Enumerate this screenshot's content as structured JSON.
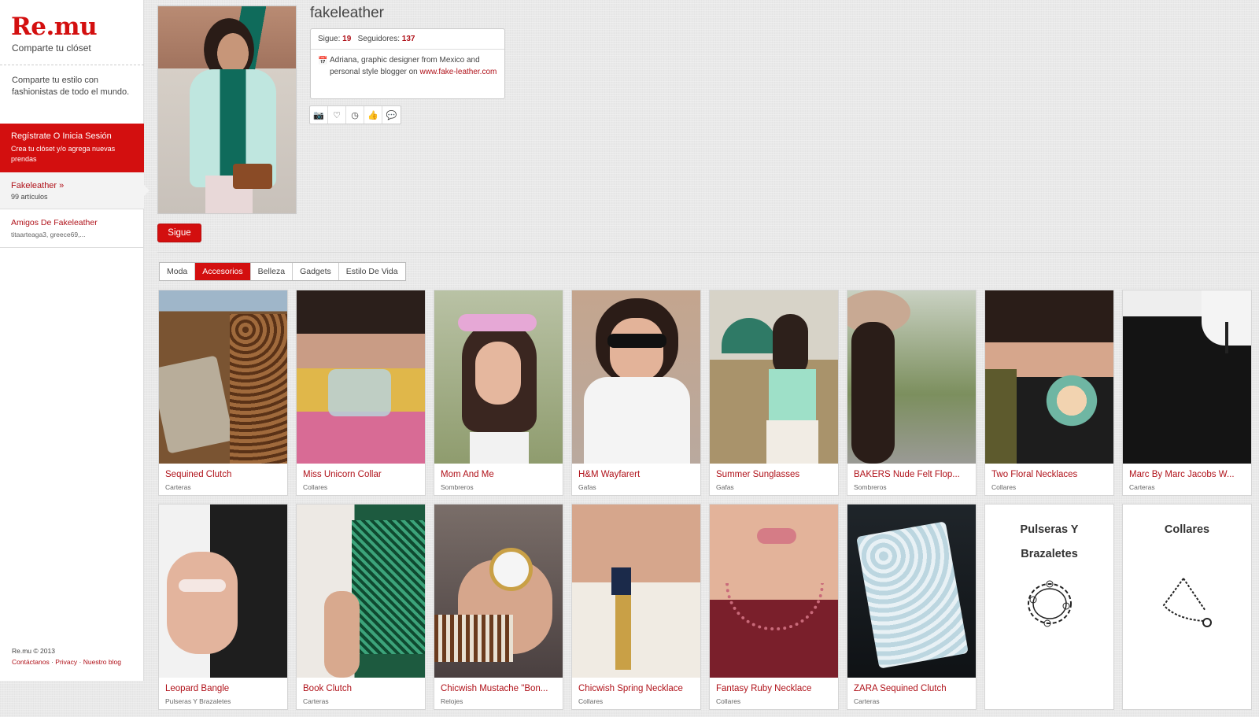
{
  "sidebar": {
    "logo": "Re.mu",
    "tagline": "Comparte tu clóset",
    "intro": "Comparte tu estilo con fashionistas de todo el mundo.",
    "register_title": "Regístrate O Inicia Sesión",
    "register_sub": "Crea tu clóset y/o agrega nuevas prendas",
    "profile_name": "Fakeleather »",
    "profile_count": "99 artículos",
    "friends_title": "Amigos De Fakeleather",
    "friends_list": "titaarteaga3, greece69,...",
    "copyright": "Re.mu © 2013",
    "link_contact": "Contáctanos",
    "sep": " · ",
    "link_privacy": "Privacy",
    "link_blog": "Nuestro blog"
  },
  "profile": {
    "username": "fakeleather",
    "follows_label": "Sigue: ",
    "follows": "19",
    "followers_label": "Seguidores: ",
    "followers": "137",
    "bio_text": "Adriana, graphic designer from Mexico and personal style blogger on ",
    "bio_link": "www.fake-leather.com",
    "follow_button": "Sigue",
    "icons": [
      "camera-icon",
      "heart-icon",
      "clock-icon",
      "thumbs-up-icon",
      "comment-icon"
    ],
    "icon_glyphs": [
      "📷",
      "♡",
      "◷",
      "👍",
      "💬"
    ]
  },
  "tabs": [
    "Moda",
    "Accesorios",
    "Belleza",
    "Gadgets",
    "Estilo De Vida"
  ],
  "active_tab": "Accesorios",
  "items": [
    {
      "title": "Sequined Clutch",
      "category": "Carteras"
    },
    {
      "title": "Miss Unicorn Collar",
      "category": "Collares"
    },
    {
      "title": "Mom And Me",
      "category": "Sombreros"
    },
    {
      "title": "H&M Wayfarert",
      "category": "Gafas"
    },
    {
      "title": "Summer Sunglasses",
      "category": "Gafas"
    },
    {
      "title": "BAKERS Nude Felt Flop...",
      "category": "Sombreros"
    },
    {
      "title": "Two Floral Necklaces",
      "category": "Collares"
    },
    {
      "title": "Marc By Marc Jacobs W...",
      "category": "Carteras"
    },
    {
      "title": "Leopard Bangle",
      "category": "Pulseras Y Brazaletes"
    },
    {
      "title": "Book Clutch",
      "category": "Carteras"
    },
    {
      "title": "Chicwish Mustache \"Bon...",
      "category": "Relojes"
    },
    {
      "title": "Chicwish Spring Necklace",
      "category": "Collares"
    },
    {
      "title": "Fantasy Ruby Necklace",
      "category": "Collares"
    },
    {
      "title": "ZARA Sequined Clutch",
      "category": "Carteras"
    }
  ],
  "category_cards": [
    {
      "title": "Pulseras Y Brazaletes",
      "icon": "bracelet-icon"
    },
    {
      "title": "Collares",
      "icon": "necklace-icon"
    }
  ],
  "colors": {
    "brand": "#d30f0f",
    "link": "#b0121a"
  }
}
